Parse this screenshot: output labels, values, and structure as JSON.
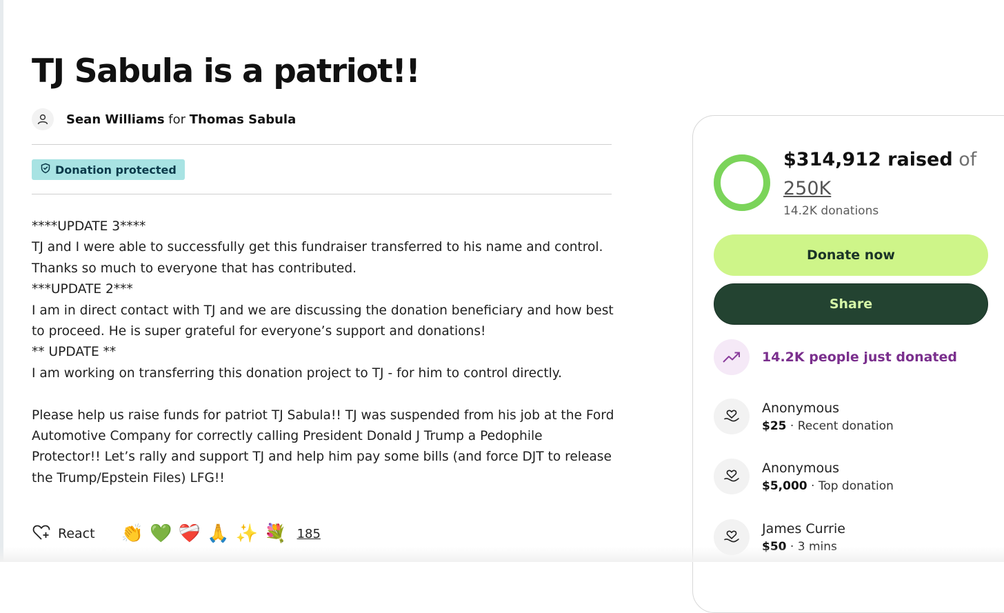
{
  "campaign": {
    "title": "TJ Sabula is a patriot!!",
    "organizer_name": "Sean Williams",
    "for_word": "for",
    "beneficiary_name": "Thomas Sabula",
    "badge_label": "Donation protected"
  },
  "story": {
    "lines": [
      "****UPDATE 3****",
      "TJ and I were able to successfully get this fundraiser transferred to his name and control.",
      "Thanks so much to everyone that has contributed.",
      "***UPDATE 2***",
      "I am in direct contact with TJ and we are discussing the donation beneficiary and how best",
      "to proceed. He is super grateful for everyone’s support and donations!",
      "** UPDATE **",
      "I am working on transferring this donation project to TJ - for him to control directly.",
      "",
      "Please help us raise funds for patriot TJ Sabula!! TJ was suspended from his job at the Ford",
      "Automotive Company for correctly calling President Donald J Trump a Pedophile",
      "Protector!! Let’s rally and support TJ and help him pay some bills (and force DJT to release",
      "the Trump/Epstein Files) LFG!!"
    ]
  },
  "reactions": {
    "react_label": "React",
    "emojis": [
      "👏",
      "💚",
      "❤️‍🩹",
      "🙏",
      "✨",
      "💐"
    ],
    "count": "185"
  },
  "fundraiser": {
    "raised_amount": "$314,912 raised",
    "of_word": "of",
    "goal": "250K",
    "donations_count": "14.2K donations",
    "progress_fraction": 1.0,
    "ring_color": "#7bd45a",
    "ring_track_color": "#d8f0c8",
    "donate_label": "Donate now",
    "share_label": "Share",
    "trend_text": "14.2K people just donated"
  },
  "donors": [
    {
      "name": "Anonymous",
      "amount": "$25",
      "detail": "Recent donation"
    },
    {
      "name": "Anonymous",
      "amount": "$5,000",
      "detail": "Top donation"
    },
    {
      "name": "James Currie",
      "amount": "$50",
      "detail": "3 mins"
    }
  ],
  "icons": {
    "avatar": "person-icon",
    "badge": "shield-icon",
    "react": "heart-plus-icon",
    "trend": "trending-up-icon",
    "donor": "heart-hand-icon"
  },
  "colors": {
    "accent_green": "#cef589",
    "dark_green": "#234331",
    "purple": "#7a2f8d",
    "badge_bg": "#a8e3e3"
  }
}
